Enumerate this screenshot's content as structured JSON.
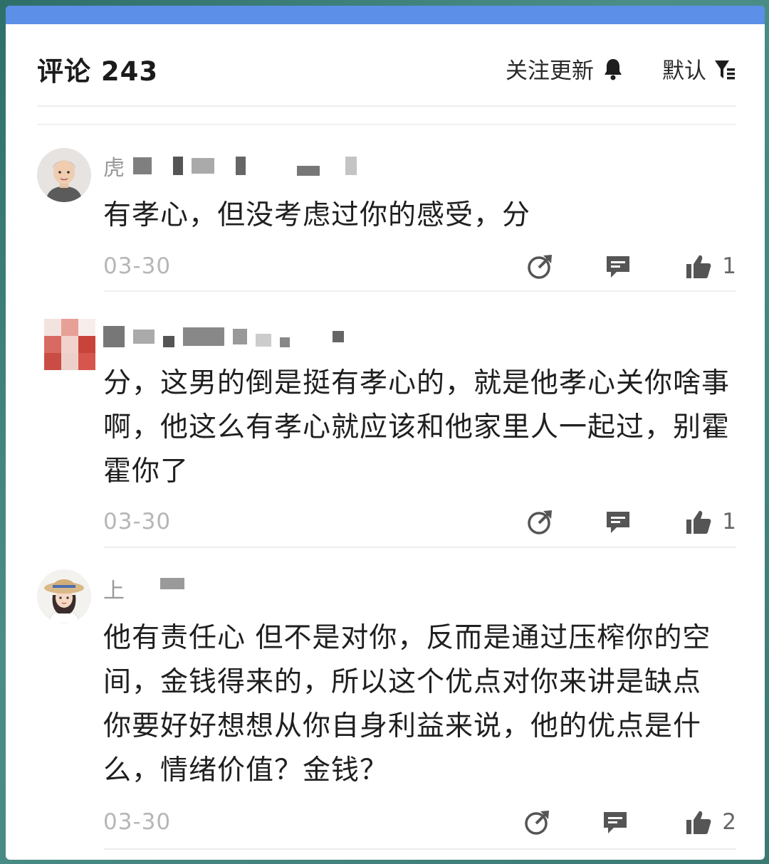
{
  "header": {
    "title": "评论 243",
    "follow_label": "关注更新",
    "sort_label": "默认"
  },
  "colors": {
    "accent_bar": "#5b8fe8",
    "text_primary": "#1f1f1f",
    "text_secondary": "#b6b6b6"
  },
  "comments": [
    {
      "username_visible": "虎",
      "avatar": "man-avatar",
      "text": "有孝心，但没考虑过你的感受，分",
      "date": "03-30",
      "likes": "1"
    },
    {
      "username_visible": "",
      "avatar": "pixelated-avatar",
      "text": "分，这男的倒是挺有孝心的，就是他孝心关你啥事啊，他这么有孝心就应该和他家里人一起过，别霍霍你了",
      "date": "03-30",
      "likes": "1"
    },
    {
      "username_visible": "上",
      "avatar": "woman-hat-avatar",
      "text": "他有责任心  但不是对你，反而是通过压榨你的空间，金钱得来的，所以这个优点对你来讲是缺点  你要好好想想从你自身利益来说，他的优点是什么，情绪价值？金钱？",
      "date": "03-30",
      "likes": "2"
    }
  ],
  "icons": {
    "follow": "bell-icon",
    "sort": "filter-icon",
    "share": "share-icon",
    "reply": "reply-icon",
    "like": "thumbs-up-icon"
  }
}
